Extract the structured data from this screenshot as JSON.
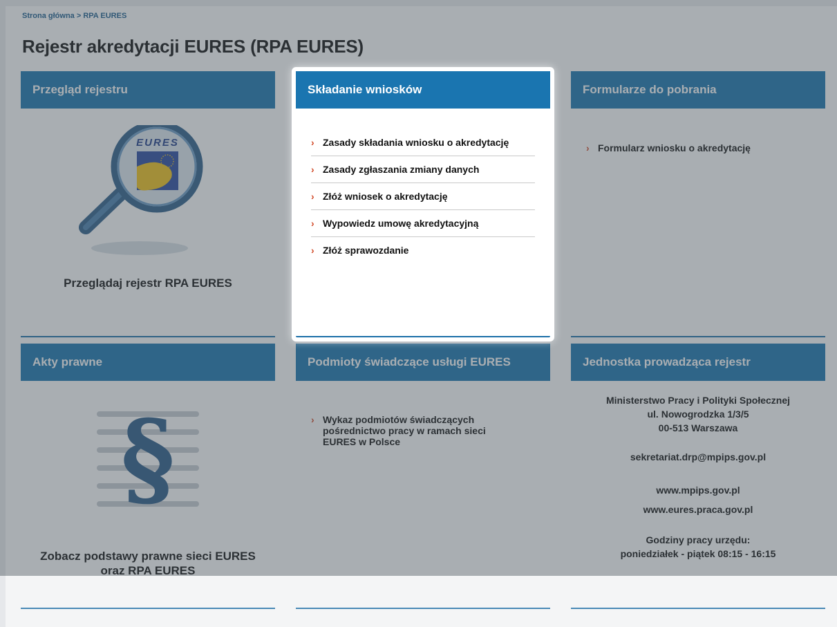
{
  "breadcrumb": {
    "home": "Strona główna",
    "separator": " > ",
    "current": "RPA EURES"
  },
  "title": "Rejestr akredytacji EURES (RPA EURES)",
  "cards": {
    "przeglad": {
      "header": "Przegląd rejestru",
      "caption": "Przeglądaj rejestr RPA EURES",
      "logo_text": "EURES"
    },
    "skladanie": {
      "header": "Składanie wniosków",
      "links": [
        "Zasady składania wniosku o akredytację",
        "Zasady zgłaszania zmiany danych",
        "Złóż wniosek o akredytację",
        "Wypowiedz umowę akredytacyjną",
        "Złóż sprawozdanie"
      ]
    },
    "formularze": {
      "header": "Formularze do pobrania",
      "links": [
        "Formularz wniosku o akredytację"
      ]
    },
    "akty": {
      "header": "Akty prawne",
      "caption_line1": "Zobacz podstawy prawne sieci EURES",
      "caption_line2": "oraz RPA EURES",
      "symbol": "§"
    },
    "podmioty": {
      "header": "Podmioty świadczące usługi EURES",
      "link_lines": [
        "Wykaz podmiotów świadczących",
        "pośrednictwo pracy w ramach sieci",
        "EURES w Polsce"
      ]
    },
    "jednostka": {
      "header": "Jednostka prowadząca rejestr",
      "org": "Ministerstwo Pracy i Polityki Społecznej",
      "street": "ul. Nowogrodzka 1/3/5",
      "city": "00-513 Warszawa",
      "email": "sekretariat.drp@mpips.gov.pl",
      "web1": "www.mpips.gov.pl",
      "web2": "www.eures.praca.gov.pl",
      "hours_label": "Godziny pracy urzędu:",
      "hours": "poniedziałek - piątek 08:15 - 16:15"
    }
  },
  "colors": {
    "header_blue": "#1a75b0",
    "bullet_red": "#d24b2a",
    "breadcrumb_blue": "#1b5e8f",
    "overlay": "#48525c"
  },
  "icons": {
    "bullet": "chevron-right-icon",
    "card1": "magnifier-eures-icon",
    "card4": "paragraph-section-icon"
  }
}
